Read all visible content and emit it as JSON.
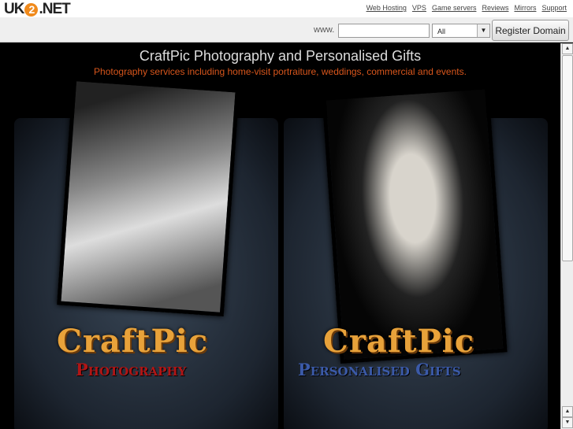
{
  "header": {
    "logo": "UK2.NET",
    "logo_parts": [
      "UK",
      "2",
      ".NET"
    ],
    "links": [
      "Web Hosting",
      "VPS",
      "Game servers",
      "Reviews",
      "Mirrors",
      "Support"
    ]
  },
  "domain_bar": {
    "prefix": "www.",
    "input_value": "",
    "tld_selected": "All",
    "register_label": "Register Domain"
  },
  "page": {
    "title": "CraftPic Photography and Personalised Gifts",
    "subtitle": "Photography services including home-visit portraiture, weddings, commercial and events.",
    "panels": [
      {
        "brand": "CraftPic",
        "tagline": "Photography"
      },
      {
        "brand": "CraftPic",
        "tagline": "Personalised Gifts"
      }
    ]
  },
  "colors": {
    "accent": "#d8561c",
    "logo_orange": "#f08a1c"
  }
}
